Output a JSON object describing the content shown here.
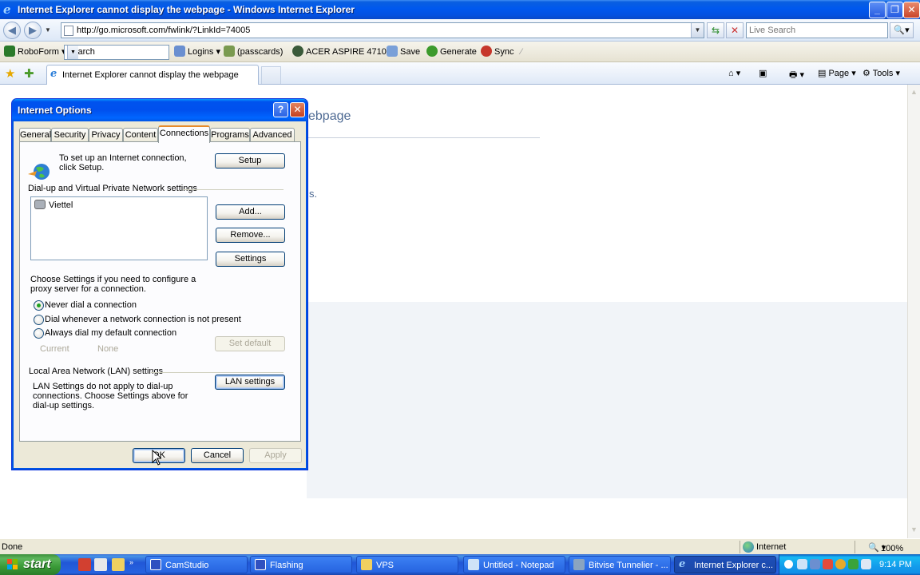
{
  "window": {
    "title": "Internet Explorer cannot display the webpage - Windows Internet Explorer"
  },
  "addressbar": {
    "url": "http://go.microsoft.com/fwlink/?LinkId=74005",
    "search_placeholder": "Live Search"
  },
  "roboform": {
    "brand": "RoboForm",
    "search_value": "Search",
    "logins": "Logins",
    "passcards": "(passcards)",
    "identity": "ACER ASPIRE 4710",
    "save": "Save",
    "generate": "Generate",
    "sync": "Sync"
  },
  "tabs": [
    {
      "label": "Internet Explorer cannot display the webpage"
    }
  ],
  "commandbar": {
    "page": "Page",
    "tools": "Tools"
  },
  "page": {
    "heading_fragment": "ebpage",
    "text_fragment": "s."
  },
  "dialog": {
    "title": "Internet Options",
    "tabs": [
      "General",
      "Security",
      "Privacy",
      "Content",
      "Connections",
      "Programs",
      "Advanced"
    ],
    "selected_tab": "Connections",
    "setup_text": "To set up an Internet connection, click Setup.",
    "setup_button": "Setup",
    "vpn_header": "Dial-up and Virtual Private Network settings",
    "connections_list": [
      "Viettel"
    ],
    "add_button": "Add...",
    "remove_button": "Remove...",
    "settings_button": "Settings",
    "proxy_text": "Choose Settings if you need to configure a proxy server for a connection.",
    "radio_options": [
      {
        "label": "Never dial a connection",
        "selected": true
      },
      {
        "label": "Dial whenever a network connection is not present",
        "selected": false
      },
      {
        "label": "Always dial my default connection",
        "selected": false
      }
    ],
    "current_label": "Current",
    "current_value": "None",
    "set_default_button": "Set default",
    "lan_header": "Local Area Network (LAN) settings",
    "lan_text": "LAN Settings do not apply to dial-up connections. Choose Settings above for dial-up settings.",
    "lan_button": "LAN settings",
    "ok_button": "OK",
    "cancel_button": "Cancel",
    "apply_button": "Apply"
  },
  "status": {
    "text": "Done",
    "zone": "Internet",
    "zoom": "100%"
  },
  "taskbar": {
    "start": "start",
    "tasks": [
      {
        "label": "CamStudio",
        "active": false
      },
      {
        "label": "Flashing",
        "active": false
      },
      {
        "label": "VPS",
        "active": false
      },
      {
        "label": "Untitled - Notepad",
        "active": false
      },
      {
        "label": "Bitvise Tunnelier - ...",
        "active": false
      },
      {
        "label": "Internet Explorer c...",
        "active": true
      }
    ],
    "clock": "9:14 PM"
  },
  "colors": {
    "xp_blue": "#0054e3",
    "tab_highlight": "#e68b2c",
    "heading_blue": "#4e6a93",
    "start_green": "#3a9a37"
  }
}
